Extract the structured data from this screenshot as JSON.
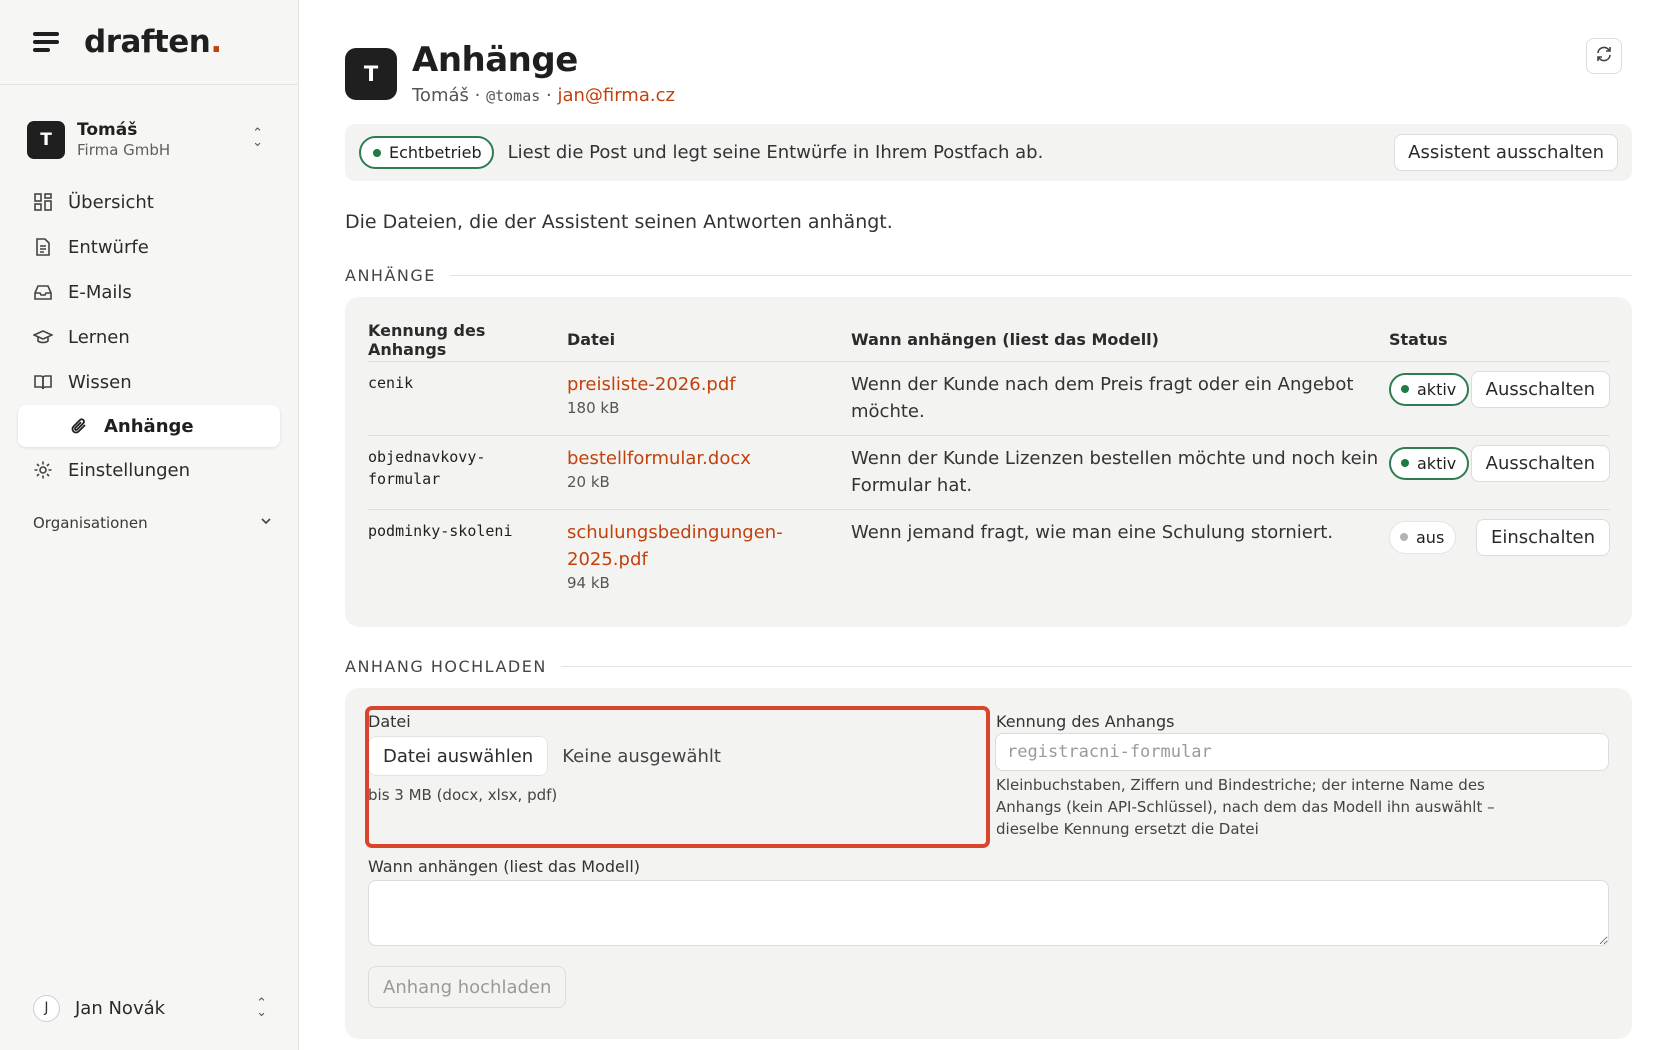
{
  "brand": {
    "name": "draften",
    "dot": "."
  },
  "org": {
    "initial": "T",
    "name": "Tomáš",
    "company": "Firma GmbH"
  },
  "nav": {
    "items": [
      {
        "label": "Übersicht",
        "icon": "dashboard-icon"
      },
      {
        "label": "Entwürfe",
        "icon": "document-icon"
      },
      {
        "label": "E-Mails",
        "icon": "inbox-icon"
      },
      {
        "label": "Lernen",
        "icon": "graduation-cap-icon"
      },
      {
        "label": "Wissen",
        "icon": "book-icon"
      },
      {
        "label": "Anhänge",
        "icon": "paperclip-icon",
        "active": true
      },
      {
        "label": "Einstellungen",
        "icon": "gear-icon"
      }
    ],
    "organisations_label": "Organisationen"
  },
  "user": {
    "initial": "J",
    "name": "Jan Novák"
  },
  "header": {
    "avatar_initial": "T",
    "title": "Anhänge",
    "name": "Tomáš",
    "separator": " · ",
    "handle": "@tomas",
    "email": "jan@firma.cz"
  },
  "banner": {
    "status": "Echtbetrieb",
    "text": "Liest die Post und legt seine Entwürfe in Ihrem Postfach ab.",
    "button": "Assistent ausschalten"
  },
  "description": "Die Dateien, die der Assistent seinen Antworten anhängt.",
  "attachments": {
    "section_title": "ANHÄNGE",
    "columns": [
      "Kennung des Anhangs",
      "Datei",
      "Wann anhängen (liest das Modell)",
      "Status"
    ],
    "rows": [
      {
        "id_line1": "cenik",
        "id_line2": "",
        "file_line1": "preisliste-2026.pdf",
        "file_line2": "",
        "size": "180 kB",
        "when": "Wenn der Kunde nach dem Preis fragt oder ein Angebot möchte.",
        "status": "aktiv",
        "action": "Ausschalten"
      },
      {
        "id_line1": "objednavkovy-",
        "id_line2": "formular",
        "file_line1": "bestellformular.docx",
        "file_line2": "",
        "size": "20 kB",
        "when": "Wenn der Kunde Lizenzen bestellen möchte und noch kein Formular hat.",
        "status": "aktiv",
        "action": "Ausschalten"
      },
      {
        "id_line1": "podminky-skoleni",
        "id_line2": "",
        "file_line1": "schulungsbedingungen-",
        "file_line2": "2025.pdf",
        "size": "94 kB",
        "when": "Wenn jemand fragt, wie man eine Schulung storniert.",
        "status": "aus",
        "action": "Einschalten"
      }
    ]
  },
  "upload": {
    "section_title": "ANHANG HOCHLADEN",
    "file_label": "Datei",
    "choose_button": "Datei auswählen",
    "no_file": "Keine ausgewählt",
    "file_hint": "bis 3 MB (docx, xlsx, pdf)",
    "id_label": "Kennung des Anhangs",
    "id_placeholder": "registracni-formular",
    "id_hint_line1": "Kleinbuchstaben, Ziffern und Bindestriche; der interne Name des",
    "id_hint_line2": "Anhangs (kein API-Schlüssel), nach dem das Modell ihn auswählt –",
    "id_hint_line3": "dieselbe Kennung ersetzt die Datei",
    "when_label": "Wann anhängen (liest das Modell)",
    "when_value": "",
    "submit": "Anhang hochladen"
  },
  "colors": {
    "accent": "#c2410c",
    "status_green": "#2f7d4f",
    "highlight": "#d9452b"
  }
}
